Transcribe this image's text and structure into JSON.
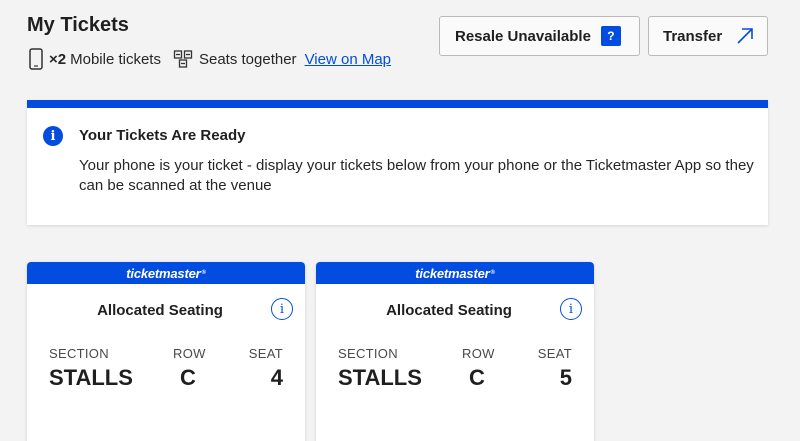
{
  "header": {
    "title": "My Tickets",
    "ticket_count": "×2",
    "ticket_type": "Mobile tickets",
    "seats_text": "Seats together",
    "map_link": "View on Map"
  },
  "actions": {
    "resale_label": "Resale Unavailable",
    "resale_help": "?",
    "transfer_label": "Transfer"
  },
  "notice": {
    "heading": "Your Tickets Are Ready",
    "body": "Your phone is your ticket - display your tickets below from your phone or the Ticketmaster App so they can be scanned at the venue"
  },
  "brand": "ticketmaster",
  "colors": {
    "accent": "#024ddf"
  },
  "tickets": [
    {
      "seating": "Allocated Seating",
      "section_label": "SECTION",
      "section": "STALLS",
      "row_label": "ROW",
      "row": "C",
      "seat_label": "SEAT",
      "seat": "4"
    },
    {
      "seating": "Allocated Seating",
      "section_label": "SECTION",
      "section": "STALLS",
      "row_label": "ROW",
      "row": "C",
      "seat_label": "SEAT",
      "seat": "5"
    }
  ]
}
